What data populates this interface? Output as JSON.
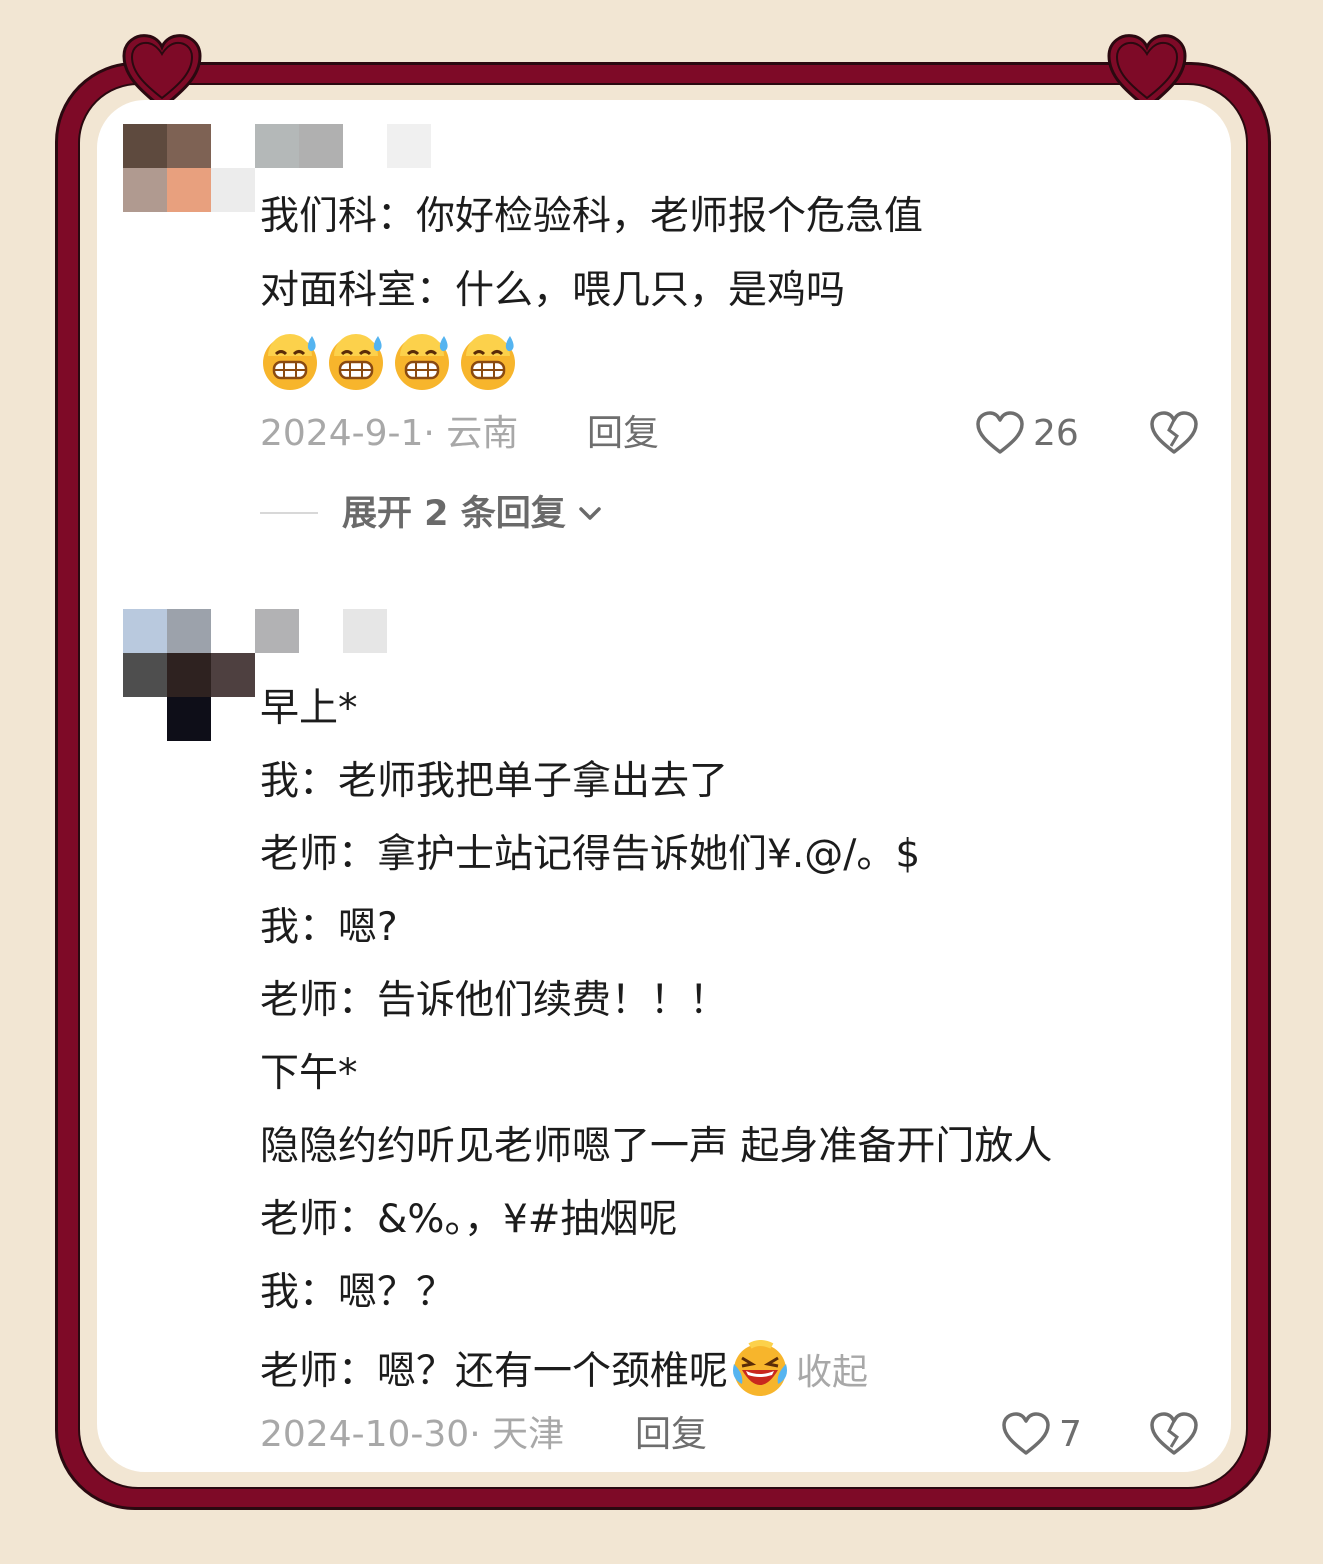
{
  "colors": {
    "frame": "#7e0a27",
    "background": "#f2e6d3",
    "card": "#ffffff",
    "text": "#1c1c1c",
    "muted": "#a8a8a8"
  },
  "comments": [
    {
      "lines": [
        "我们科：你好检验科，老师报个危急值",
        "对面科室：什么，喂几只，是鸡吗"
      ],
      "emoji_icons": [
        "grimace-sweat-icon",
        "grimace-sweat-icon",
        "grimace-sweat-icon",
        "grimace-sweat-icon"
      ],
      "meta": "2024-9-1· 云南",
      "reply_label": "回复",
      "like_count": "26",
      "expand_label": "展开 2 条回复"
    },
    {
      "lines": [
        "早上*",
        "我：老师我把单子拿出去了",
        "老师：拿护士站记得告诉她们¥.@/。$",
        "我：嗯?",
        "老师：告诉他们续费！！！",
        "下午*",
        "隐隐约约听见老师嗯了一声 起身准备开门放人",
        "老师：&%。，¥#抽烟呢",
        "我：嗯？？",
        "老师：嗯？还有一个颈椎呢"
      ],
      "collapse_label": "收起",
      "meta": "2024-10-30· 天津",
      "reply_label": "回复",
      "like_count": "7"
    }
  ]
}
